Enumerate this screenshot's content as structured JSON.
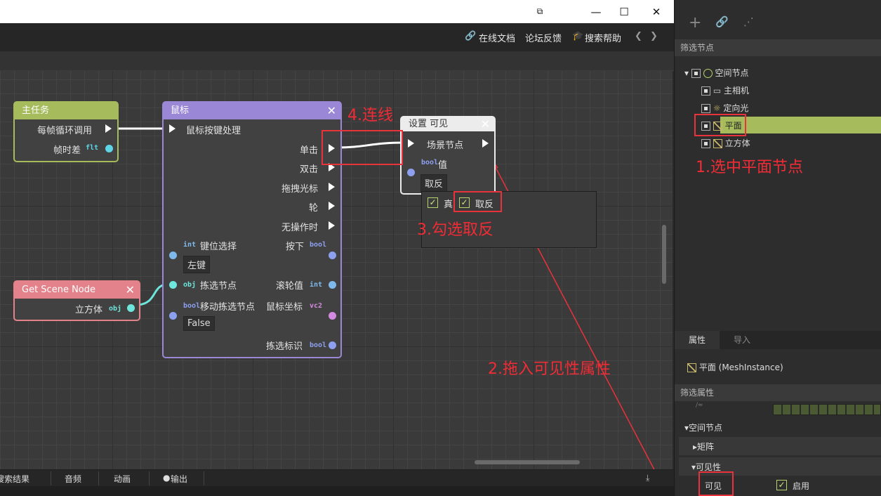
{
  "window": {
    "restore_label": "⧉",
    "minimize_label": "—",
    "maximize_label": "☐",
    "close_label": "✕"
  },
  "toolbar": {
    "online_docs": "在线文档",
    "forum_feedback": "论坛反馈",
    "search_help": "搜索帮助",
    "prev": "❮",
    "next": "❯"
  },
  "nodes": {
    "main_task": {
      "title": "主任务",
      "row1": "每帧循环调用",
      "row2": "帧时差",
      "row2_tag": "flt"
    },
    "mouse": {
      "title": "鼠标",
      "input": "鼠标按键处理",
      "outputs": [
        "单击",
        "双击",
        "拖拽光标",
        "轮",
        "无操作时"
      ],
      "key_select_tag": "int",
      "key_select": "键位选择",
      "key_select_value": "左键",
      "pressed": "按下",
      "pressed_tag": "bool",
      "pick_node_tag": "obj",
      "pick_node": "拣选节点",
      "wheel_value": "滚轮值",
      "wheel_tag": "int",
      "move_pick_tag": "bool",
      "move_pick": "移动拣选节点",
      "move_pick_value": "False",
      "mouse_coord": "鼠标坐标",
      "mouse_coord_tag": "vc2",
      "pick_id": "拣选标识",
      "pick_id_tag": "bool"
    },
    "get_scene_node": {
      "title": "Get Scene Node",
      "row1": "立方体",
      "row1_tag": "obj"
    },
    "set_visible": {
      "title": "设置 可见",
      "scene_node": "场景节点",
      "value_tag": "bool",
      "value": "值",
      "invert_label": "取反",
      "opt_true": "真",
      "opt_invert": "取反"
    }
  },
  "annotations": {
    "step1": "1.选中平面节点",
    "step2": "2.拖入可见性属性",
    "step3": "3.勾选取反",
    "step4": "4.连线"
  },
  "bottom_tabs": [
    "搜索结果",
    "音频",
    "动画",
    "输出"
  ],
  "right_panel": {
    "filter_nodes": "筛选节点",
    "tree": [
      {
        "label": "空间节点"
      },
      {
        "label": "主相机"
      },
      {
        "label": "定向光"
      },
      {
        "label": "平面"
      },
      {
        "label": "立方体"
      }
    ],
    "tabs": [
      "属性",
      "导入"
    ],
    "selected_node": "平面 (MeshInstance)",
    "filter_props": "筛选属性",
    "sections": {
      "spatial": "空间节点",
      "matrix": "矩阵",
      "visibility": "可见性"
    },
    "visible_label": "可见",
    "enabled_label": "启用"
  },
  "colors": {
    "accent_green": "#a6bc5c",
    "annotation_red": "#e8323c",
    "mouse_node": "#9a87d6",
    "get_scene_node": "#e3828a"
  }
}
